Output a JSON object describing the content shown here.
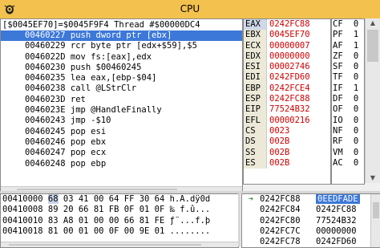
{
  "window": {
    "title": "CPU"
  },
  "disasm": {
    "header": "[$0045EF70]=$0045F9F4 Thread #$00000DC4",
    "rows": [
      "00460227 push dword ptr [ebx]",
      "00460229 rcr byte ptr [edx+$59],$5",
      "0046022D mov fs:[eax],edx",
      "00460230 push $00460245",
      "00460235 lea eax,[ebp-$04]",
      "00460238 call @LStrClr",
      "0046023D ret",
      "0046023E jmp @HandleFinally",
      "00460243 jmp -$10",
      "00460245 pop esi",
      "00460246 pop ebx",
      "00460247 pop ecx",
      "00460248 pop ebp"
    ]
  },
  "registers": [
    {
      "name": "EAX",
      "value": "0242FC88"
    },
    {
      "name": "EBX",
      "value": "0045EF70"
    },
    {
      "name": "ECX",
      "value": "00000007"
    },
    {
      "name": "EDX",
      "value": "00000000"
    },
    {
      "name": "ESI",
      "value": "00002746"
    },
    {
      "name": "EDI",
      "value": "0242FD60"
    },
    {
      "name": "EBP",
      "value": "0242FCE4"
    },
    {
      "name": "ESP",
      "value": "0242FC88"
    },
    {
      "name": "EIP",
      "value": "77524B32"
    },
    {
      "name": "EFL",
      "value": "00000216"
    },
    {
      "name": "CS",
      "value": "0023"
    },
    {
      "name": "DS",
      "value": "002B"
    },
    {
      "name": "SS",
      "value": "002B"
    },
    {
      "name": "ES",
      "value": "002B"
    }
  ],
  "flags": [
    {
      "name": "CF",
      "value": "0"
    },
    {
      "name": "PF",
      "value": "1"
    },
    {
      "name": "AF",
      "value": "1"
    },
    {
      "name": "ZF",
      "value": "0"
    },
    {
      "name": "SF",
      "value": "0"
    },
    {
      "name": "TF",
      "value": "0"
    },
    {
      "name": "IF",
      "value": "1"
    },
    {
      "name": "DF",
      "value": "0"
    },
    {
      "name": "OF",
      "value": "0"
    },
    {
      "name": "IO",
      "value": "0"
    },
    {
      "name": "NF",
      "value": "0"
    },
    {
      "name": "RF",
      "value": "0"
    },
    {
      "name": "VM",
      "value": "0"
    },
    {
      "name": "AC",
      "value": "0"
    }
  ],
  "dump": {
    "rows": [
      {
        "addr": "00410000",
        "first": "68",
        "rest": "03 41 00 64 FF 30 64",
        "ascii": "h.A.dÿ0d"
      },
      {
        "addr": "00410008",
        "first": "89",
        "rest": "20 66 81 FB 0F 01 0F",
        "ascii": "‰ f.û..."
      },
      {
        "addr": "00410010",
        "first": "83",
        "rest": "A8 01 00 00 66 81 FE",
        "ascii": "ƒ¨...f.þ"
      },
      {
        "addr": "00410018",
        "first": "81",
        "rest": "00 01 00 0F 00 9E 01",
        "ascii": "........"
      }
    ]
  },
  "stack": {
    "rows": [
      {
        "addr": "0242FC88",
        "value": "0EEDFADE"
      },
      {
        "addr": "0242FC84",
        "value": "0242FC88"
      },
      {
        "addr": "0242FC80",
        "value": "77524B32"
      },
      {
        "addr": "0242FC7C",
        "value": "00000000"
      },
      {
        "addr": "0242FC78",
        "value": "0242FD60"
      }
    ]
  }
}
